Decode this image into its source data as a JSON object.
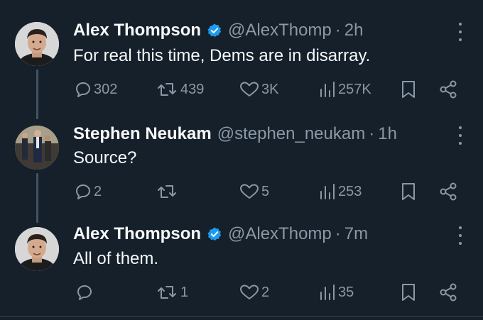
{
  "tweets": [
    {
      "name": "Alex Thompson",
      "verified": true,
      "handle": "@AlexThomp",
      "time": "2h",
      "text": "For real this time, Dems are in disarray.",
      "replies": "302",
      "retweets": "439",
      "likes": "3K",
      "views": "257K"
    },
    {
      "name": "Stephen Neukam",
      "verified": false,
      "handle": "@stephen_neukam",
      "time": "1h",
      "text": "Source?",
      "replies": "2",
      "retweets": "",
      "likes": "5",
      "views": "253"
    },
    {
      "name": "Alex Thompson",
      "verified": true,
      "handle": "@AlexThomp",
      "time": "7m",
      "text": "All of them.",
      "replies": "",
      "retweets": "1",
      "likes": "2",
      "views": "35"
    }
  ],
  "separator": "·",
  "colors": {
    "background": "#15202b",
    "text": "#f7f9f9",
    "secondary": "#8b98a5",
    "verified": "#1d9bf0",
    "thread_line": "#425364"
  },
  "icons": {
    "reply": "reply-icon",
    "retweet": "retweet-icon",
    "like": "heart-icon",
    "views": "views-icon",
    "bookmark": "bookmark-icon",
    "share": "share-icon",
    "more": "more-icon",
    "verified": "verified-badge-icon"
  }
}
